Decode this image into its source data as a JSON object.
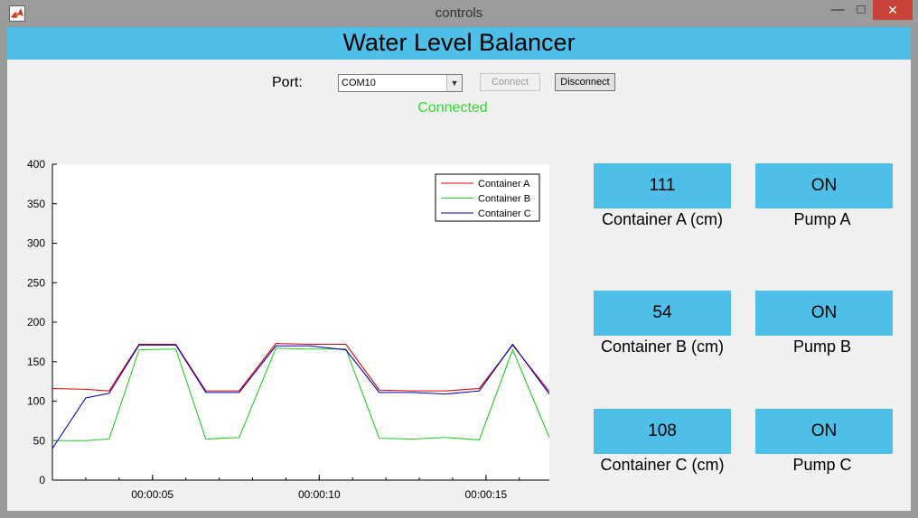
{
  "window": {
    "title": "controls",
    "minimize": "—",
    "maximize": "□",
    "close": "✕"
  },
  "app": {
    "title": "Water Level Balancer"
  },
  "port": {
    "label": "Port:",
    "value": "COM10",
    "connect_label": "Connect",
    "disconnect_label": "Disconnect",
    "status": "Connected"
  },
  "colors": {
    "banner": "#4dbfe8",
    "status": "#2bdc2b",
    "container_a": "#dd0000",
    "container_b": "#22cc22",
    "container_c": "#0000bb"
  },
  "containers": [
    {
      "value": "111",
      "label": "Container A (cm)",
      "pump_state": "ON",
      "pump_label": "Pump A"
    },
    {
      "value": "54",
      "label": "Container B (cm)",
      "pump_state": "ON",
      "pump_label": "Pump B"
    },
    {
      "value": "108",
      "label": "Container C (cm)",
      "pump_state": "ON",
      "pump_label": "Pump C"
    }
  ],
  "chart_data": {
    "type": "line",
    "x": [
      2,
      3,
      3.7,
      4.6,
      5.7,
      6.6,
      7.6,
      8.7,
      9.7,
      10.8,
      11.8,
      12.8,
      13.8,
      14.8,
      15.8,
      16.9
    ],
    "xlim": [
      2,
      16.9
    ],
    "xticks": [
      5,
      10,
      15
    ],
    "xtick_labels": [
      "00:00:05",
      "00:00:10",
      "00:00:15"
    ],
    "ylim": [
      0,
      400
    ],
    "yticks": [
      0,
      50,
      100,
      150,
      200,
      250,
      300,
      350,
      400
    ],
    "series": [
      {
        "name": "Container A",
        "color": "#dd0000",
        "values": [
          116,
          115,
          113,
          172,
          172,
          113,
          113,
          173,
          172,
          172,
          114,
          113,
          113,
          116,
          171,
          112
        ]
      },
      {
        "name": "Container B",
        "color": "#22cc22",
        "values": [
          50,
          50,
          52,
          165,
          166,
          52,
          54,
          167,
          166,
          166,
          53,
          52,
          54,
          51,
          165,
          54
        ]
      },
      {
        "name": "Container C",
        "color": "#0000bb",
        "values": [
          40,
          104,
          110,
          171,
          171,
          111,
          111,
          170,
          170,
          165,
          111,
          111,
          109,
          113,
          172,
          109
        ]
      }
    ],
    "legend": "top-right",
    "grid": false
  }
}
